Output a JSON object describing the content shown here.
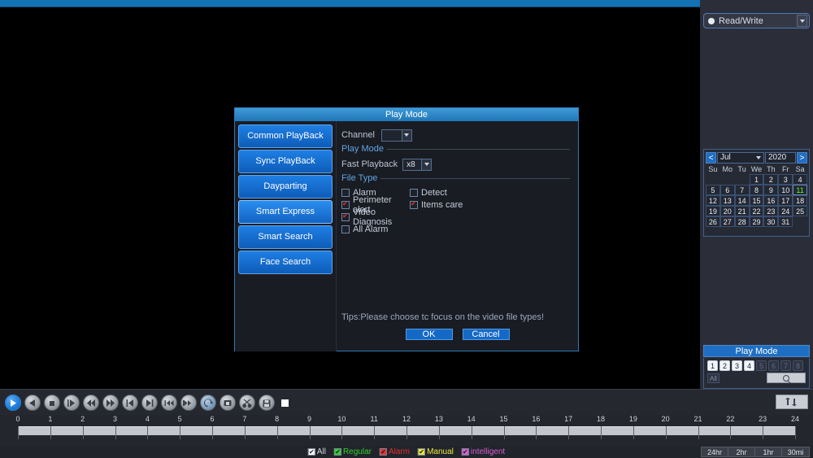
{
  "topbar": {
    "present": true
  },
  "right_panel": {
    "hdd": {
      "label": "Read/Write",
      "icon": "radio-dot-icon",
      "dropdown_icon": "chevron-down-icon"
    },
    "calendar": {
      "prev_label": "<",
      "next_label": ">",
      "month": "Jul",
      "year": "2020",
      "dow": [
        "Su",
        "Mo",
        "Tu",
        "We",
        "Th",
        "Fr",
        "Sa"
      ],
      "leading_blanks": 3,
      "days": [
        1,
        2,
        3,
        4,
        5,
        6,
        7,
        8,
        9,
        10,
        11,
        12,
        13,
        14,
        15,
        16,
        17,
        18,
        19,
        20,
        21,
        22,
        23,
        24,
        25,
        26,
        27,
        28,
        29,
        30,
        31
      ],
      "selected_day": 11,
      "selected_color": "#5bff2a"
    },
    "play_mode": {
      "title": "Play Mode",
      "channels": [
        {
          "label": "1",
          "enabled": true
        },
        {
          "label": "2",
          "enabled": true
        },
        {
          "label": "3",
          "enabled": true
        },
        {
          "label": "4",
          "enabled": true
        },
        {
          "label": "5",
          "enabled": false
        },
        {
          "label": "6",
          "enabled": false
        },
        {
          "label": "7",
          "enabled": false
        },
        {
          "label": "8",
          "enabled": false
        }
      ],
      "all_label": "All",
      "search_icon": "magnifier-icon"
    }
  },
  "dialog": {
    "title": "Play Mode",
    "sidebar": [
      {
        "label": "Common PlayBack",
        "active": false
      },
      {
        "label": "Sync PlayBack",
        "active": false
      },
      {
        "label": "Dayparting",
        "active": false
      },
      {
        "label": "Smart Express",
        "active": true
      },
      {
        "label": "Smart Search",
        "active": false
      },
      {
        "label": "Face Search",
        "active": false
      }
    ],
    "channel": {
      "label": "Channel",
      "value": ""
    },
    "play_mode_group": "Play Mode",
    "fast_playback": {
      "label": "Fast Playback",
      "value": "x8"
    },
    "file_type_group": "File Type",
    "file_types": [
      {
        "label": "Alarm",
        "checked": false
      },
      {
        "label": "Detect",
        "checked": false
      },
      {
        "label": "Perimeter alert",
        "checked": true
      },
      {
        "label": "Items care",
        "checked": true
      },
      {
        "label": "Video Diagnosis",
        "checked": true
      },
      {
        "label": "All Alarm",
        "checked": false
      }
    ],
    "tips": "Tips:Please choose tc focus on the video file types!",
    "ok_label": "OK",
    "cancel_label": "Cancel"
  },
  "controls": {
    "buttons": [
      {
        "name": "play-button",
        "icon": "play-icon",
        "style": "primary"
      },
      {
        "name": "reverse-play-button",
        "icon": "reverse-play-icon",
        "style": "normal"
      },
      {
        "name": "stop-button",
        "icon": "stop-icon",
        "style": "normal"
      },
      {
        "name": "slow-play-button",
        "icon": "slow-play-icon",
        "style": "normal"
      },
      {
        "name": "rewind-button",
        "icon": "rewind-icon",
        "style": "normal"
      },
      {
        "name": "fast-forward-button",
        "icon": "fast-forward-icon",
        "style": "normal"
      },
      {
        "name": "previous-frame-button",
        "icon": "skip-previous-icon",
        "style": "normal"
      },
      {
        "name": "next-frame-button",
        "icon": "skip-next-icon",
        "style": "normal"
      },
      {
        "name": "previous-file-button",
        "icon": "previous-file-icon",
        "style": "normal"
      },
      {
        "name": "next-file-button",
        "icon": "next-file-icon",
        "style": "normal"
      },
      {
        "name": "loop-button",
        "icon": "loop-icon",
        "style": "tinted"
      },
      {
        "name": "mark-button",
        "icon": "mark-icon",
        "style": "normal"
      },
      {
        "name": "clip-button",
        "icon": "scissors-icon",
        "style": "normal"
      },
      {
        "name": "save-button",
        "icon": "save-disk-icon",
        "style": "normal"
      }
    ],
    "record_indicator": "record-square-indicator",
    "swap_button": {
      "name": "backup-swap-button",
      "icon": "swap-arrows-icon"
    }
  },
  "timeline": {
    "hour_labels": [
      "0",
      "1",
      "2",
      "3",
      "4",
      "5",
      "6",
      "7",
      "8",
      "9",
      "10",
      "11",
      "12",
      "13",
      "14",
      "15",
      "16",
      "17",
      "18",
      "19",
      "20",
      "21",
      "22",
      "23",
      "24"
    ],
    "range_start": 0,
    "range_end": 24
  },
  "legend": {
    "items": [
      {
        "label": "All",
        "color": "#ffffff",
        "checked": true
      },
      {
        "label": "Regular",
        "color": "#2fd02f",
        "checked": true
      },
      {
        "label": "Alarm",
        "color": "#e53030",
        "checked": true
      },
      {
        "label": "Manual",
        "color": "#e8e83a",
        "checked": true
      },
      {
        "label": "intelligent",
        "color": "#d45fd4",
        "checked": true
      }
    ]
  },
  "time_scale_buttons": [
    "24hr",
    "2hr",
    "1hr",
    "30mi"
  ]
}
